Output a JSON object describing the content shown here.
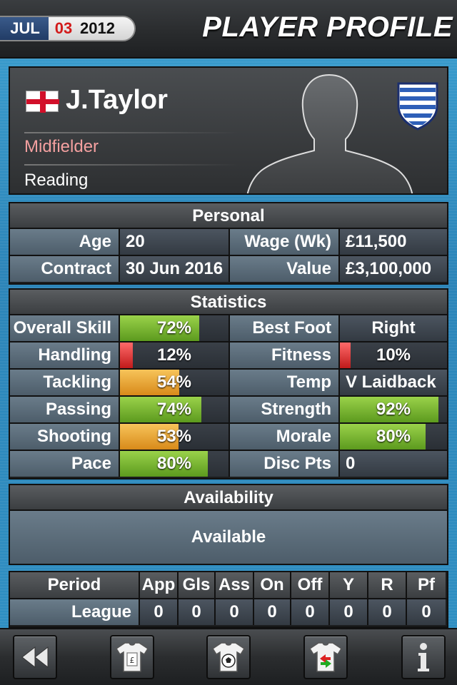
{
  "header": {
    "date_month": "JUL",
    "date_day": "03",
    "date_year": "2012",
    "title": "PLAYER PROFILE"
  },
  "player": {
    "name": "J.Taylor",
    "position": "Midfielder",
    "club": "Reading",
    "flag_icon": "england-flag-icon",
    "crest_icon": "club-crest-icon"
  },
  "personal": {
    "heading": "Personal",
    "rows": [
      {
        "label1": "Age",
        "value1": "20",
        "label2": "Wage (Wk)",
        "value2": "£11,500"
      },
      {
        "label1": "Contract",
        "value1": "30 Jun 2016",
        "label2": "Value",
        "value2": "£3,100,000"
      }
    ]
  },
  "statistics": {
    "heading": "Statistics",
    "left": [
      {
        "label": "Overall Skill",
        "text": "72%",
        "level": 0.72,
        "color": "green"
      },
      {
        "label": "Handling",
        "text": "12%",
        "level": 0.12,
        "color": "red"
      },
      {
        "label": "Tackling",
        "text": "54%",
        "level": 0.54,
        "color": "orange"
      },
      {
        "label": "Passing",
        "text": "74%",
        "level": 0.74,
        "color": "green"
      },
      {
        "label": "Shooting",
        "text": "53%",
        "level": 0.53,
        "color": "orange"
      },
      {
        "label": "Pace",
        "text": "80%",
        "level": 0.8,
        "color": "green"
      }
    ],
    "right": [
      {
        "label": "Best Foot",
        "text": "Right",
        "level": null,
        "color": null
      },
      {
        "label": "Fitness",
        "text": "10%",
        "level": 0.1,
        "color": "red"
      },
      {
        "label": "Temp",
        "text": "V Laidback",
        "level": null,
        "color": null
      },
      {
        "label": "Strength",
        "text": "92%",
        "level": 0.92,
        "color": "green"
      },
      {
        "label": "Morale",
        "text": "80%",
        "level": 0.8,
        "color": "green"
      },
      {
        "label": "Disc Pts",
        "text": "0",
        "level": null,
        "color": null
      }
    ]
  },
  "availability": {
    "heading": "Availability",
    "status": "Available"
  },
  "history": {
    "columns": [
      "Period",
      "App",
      "Gls",
      "Ass",
      "On",
      "Off",
      "Y",
      "R",
      "Pf"
    ],
    "rows": [
      [
        "League",
        "0",
        "0",
        "0",
        "0",
        "0",
        "0",
        "0",
        "0"
      ]
    ]
  },
  "toolbar": {
    "buttons": [
      "back-icon",
      "contract-shirt-icon",
      "ball-shirt-icon",
      "transfer-shirt-icon",
      "info-icon"
    ]
  },
  "colors": {
    "green": "#7bbf2e",
    "orange": "#eea53a",
    "red": "#e0302f",
    "position_text": "#f4a0a0",
    "date_day": "#d21a1a"
  }
}
